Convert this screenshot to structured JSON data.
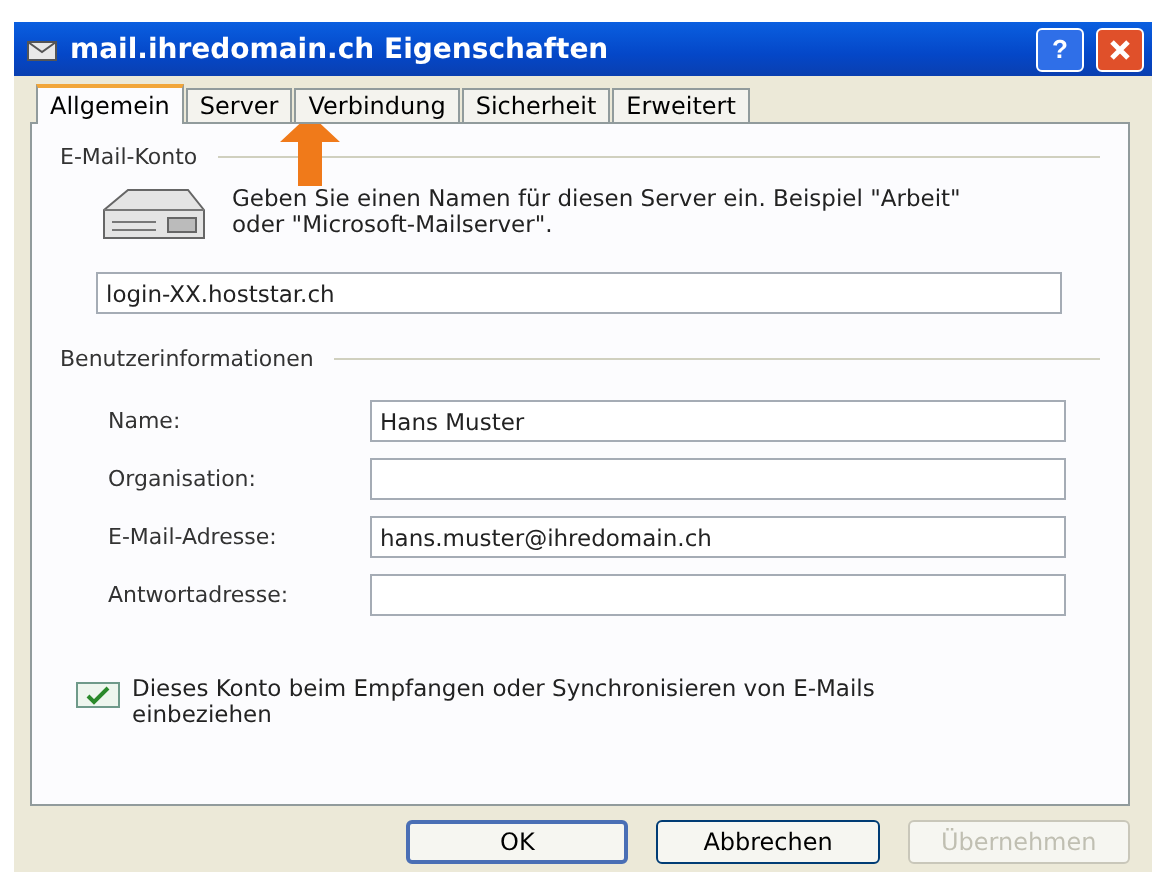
{
  "window": {
    "title": "mail.ihredomain.ch Eigenschaften",
    "help_button": "?"
  },
  "tabs": [
    {
      "label": "Allgemein",
      "selected": true
    },
    {
      "label": "Server",
      "selected": false
    },
    {
      "label": "Verbindung",
      "selected": false
    },
    {
      "label": "Sicherheit",
      "selected": false
    },
    {
      "label": "Erweitert",
      "selected": false
    }
  ],
  "account": {
    "heading": "E-Mail-Konto",
    "description": "Geben Sie einen Namen für diesen Server ein. Beispiel \"Arbeit\" oder \"Microsoft-Mailserver\".",
    "server_name": "login-XX.hoststar.ch"
  },
  "user_info": {
    "heading": "Benutzerinformationen",
    "fields": [
      {
        "label": "Name:",
        "value": "Hans Muster"
      },
      {
        "label": "Organisation:"
      },
      {
        "label": "E-Mail-Adresse:",
        "value": "hans.muster@ihredomain.ch"
      },
      {
        "label": "Antwortadresse:"
      }
    ]
  },
  "include_checkbox": {
    "label": "Dieses Konto beim Empfangen oder Synchronisieren von E-Mails einbeziehen",
    "checked": true
  },
  "buttons": [
    {
      "label": "OK",
      "default": true,
      "disabled": false
    },
    {
      "label": "Abbrechen",
      "default": false,
      "disabled": false
    },
    {
      "label": "Übernehmen",
      "default": false,
      "disabled": true
    }
  ]
}
